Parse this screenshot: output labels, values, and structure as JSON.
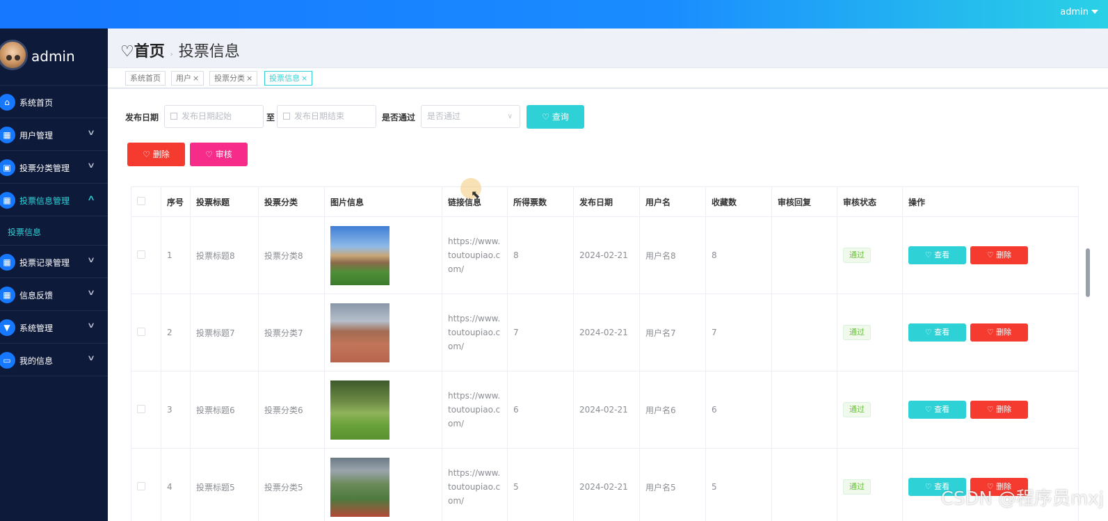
{
  "topbar": {
    "user": "admin"
  },
  "sidebar": {
    "username": "admin",
    "items": [
      {
        "label": "系统首页",
        "icon": "home-icon",
        "glyph": "⌂",
        "arrow": ""
      },
      {
        "label": "用户管理",
        "icon": "grid-icon",
        "glyph": "▦",
        "arrow": "v"
      },
      {
        "label": "投票分类管理",
        "icon": "clipboard-icon",
        "glyph": "▣",
        "arrow": "v"
      },
      {
        "label": "投票信息管理",
        "icon": "grid-icon",
        "glyph": "▦",
        "arrow": "^"
      },
      {
        "label": "投票记录管理",
        "icon": "grid-icon",
        "glyph": "▦",
        "arrow": "v"
      },
      {
        "label": "信息反馈",
        "icon": "grid-icon",
        "glyph": "▦",
        "arrow": "v"
      },
      {
        "label": "系统管理",
        "icon": "funnel-icon",
        "glyph": "▼",
        "arrow": "v"
      },
      {
        "label": "我的信息",
        "icon": "card-icon",
        "glyph": "▭",
        "arrow": "v"
      }
    ],
    "subitem": "投票信息"
  },
  "breadcrumb": {
    "home": "首页",
    "separator": "›",
    "current": "投票信息"
  },
  "tags": [
    {
      "label": "系统首页",
      "closable": false
    },
    {
      "label": "用户",
      "closable": true
    },
    {
      "label": "投票分类",
      "closable": true
    },
    {
      "label": "投票信息",
      "closable": true
    }
  ],
  "close_glyph": "×",
  "filters": {
    "date_label": "发布日期",
    "date_start_placeholder": "发布日期起始",
    "date_to": "至",
    "date_end_placeholder": "发布日期结束",
    "pass_label": "是否通过",
    "pass_placeholder": "是否通过",
    "query_button": "♡ 查询"
  },
  "actions": {
    "delete": "♡ 删除",
    "audit": "♡ 审核"
  },
  "table": {
    "headers": [
      "",
      "序号",
      "投票标题",
      "投票分类",
      "图片信息",
      "链接信息",
      "所得票数",
      "发布日期",
      "用户名",
      "收藏数",
      "审核回复",
      "审核状态",
      "操作"
    ],
    "rows": [
      {
        "index": "1",
        "title": "投票标题8",
        "category": "投票分类8",
        "link": "https://www.toutoupiao.com/",
        "votes": "8",
        "date": "2024-02-21",
        "user": "用户名8",
        "favs": "8",
        "reply": "",
        "status": "通过"
      },
      {
        "index": "2",
        "title": "投票标题7",
        "category": "投票分类7",
        "link": "https://www.toutoupiao.com/",
        "votes": "7",
        "date": "2024-02-21",
        "user": "用户名7",
        "favs": "7",
        "reply": "",
        "status": "通过"
      },
      {
        "index": "3",
        "title": "投票标题6",
        "category": "投票分类6",
        "link": "https://www.toutoupiao.com/",
        "votes": "6",
        "date": "2024-02-21",
        "user": "用户名6",
        "favs": "6",
        "reply": "",
        "status": "通过"
      },
      {
        "index": "4",
        "title": "投票标题5",
        "category": "投票分类5",
        "link": "https://www.toutoupiao.com/",
        "votes": "5",
        "date": "2024-02-21",
        "user": "用户名5",
        "favs": "5",
        "reply": "",
        "status": "通过"
      }
    ],
    "view_label": "♡ 查看",
    "delete_label": "♡ 删除"
  },
  "watermark": "CSDN @程序员mxj",
  "colors": {
    "accent": "#2ed1d6",
    "danger": "#f53b30",
    "pink": "#f72b8a",
    "sidebar_bg": "#0d1a3a",
    "topbar": "#1677ff"
  }
}
